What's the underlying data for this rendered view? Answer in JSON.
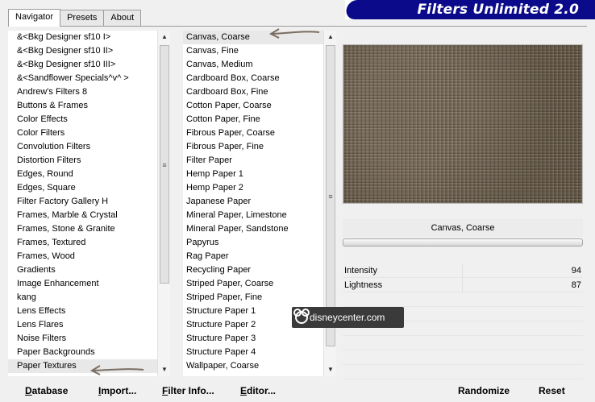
{
  "tabs": [
    "Navigator",
    "Presets",
    "About"
  ],
  "banner_title": "Filters Unlimited 2.0",
  "categories": [
    "&<Bkg Designer sf10 I>",
    "&<Bkg Designer sf10 II>",
    "&<Bkg Designer sf10 III>",
    "&<Sandflower Specials^v^ >",
    "Andrew's Filters 8",
    "Buttons & Frames",
    "Color Effects",
    "Color Filters",
    "Convolution Filters",
    "Distortion Filters",
    "Edges, Round",
    "Edges, Square",
    "Filter Factory Gallery H",
    "Frames, Marble & Crystal",
    "Frames, Stone & Granite",
    "Frames, Textured",
    "Frames, Wood",
    "Gradients",
    "Image Enhancement",
    "kang",
    "Lens Effects",
    "Lens Flares",
    "Noise Filters",
    "Paper Backgrounds",
    "Paper Textures"
  ],
  "selected_category": "Paper Textures",
  "filters": [
    "Canvas, Coarse",
    "Canvas, Fine",
    "Canvas, Medium",
    "Cardboard Box, Coarse",
    "Cardboard Box, Fine",
    "Cotton Paper, Coarse",
    "Cotton Paper, Fine",
    "Fibrous Paper, Coarse",
    "Fibrous Paper, Fine",
    "Filter Paper",
    "Hemp Paper 1",
    "Hemp Paper 2",
    "Japanese Paper",
    "Mineral Paper, Limestone",
    "Mineral Paper, Sandstone",
    "Papyrus",
    "Rag Paper",
    "Recycling Paper",
    "Striped Paper, Coarse",
    "Striped Paper, Fine",
    "Structure Paper 1",
    "Structure Paper 2",
    "Structure Paper 3",
    "Structure Paper 4",
    "Wallpaper, Coarse"
  ],
  "selected_filter": "Canvas, Coarse",
  "filter_name_display": "Canvas, Coarse",
  "params": [
    {
      "label": "Intensity",
      "value": "94"
    },
    {
      "label": "Lightness",
      "value": "87"
    }
  ],
  "watermark": "disneycenter.com",
  "buttons": {
    "database": "Database",
    "import": "Import...",
    "filter_info": "Filter Info...",
    "editor": "Editor...",
    "randomize": "Randomize",
    "reset": "Reset"
  },
  "colors": {
    "banner": "#0a0a8a",
    "preview_texture": "#6f6252",
    "annotation_arrow": "#7a6e62"
  }
}
